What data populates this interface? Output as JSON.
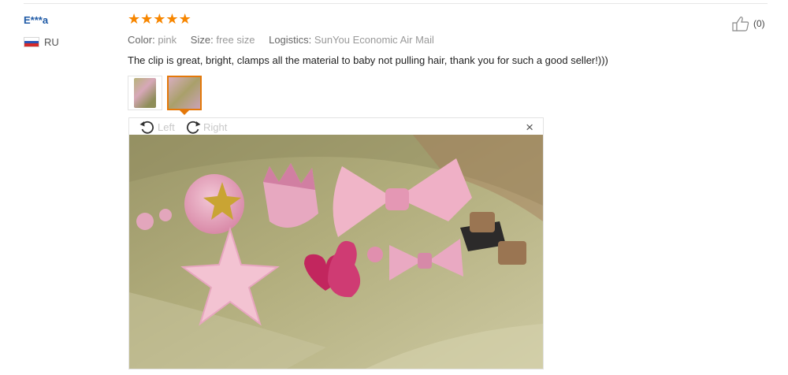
{
  "review": {
    "user": "E***a",
    "country_code": "RU",
    "rating": 5,
    "color_key": "Color:",
    "color_value": "pink",
    "size_key": "Size:",
    "size_value": "free size",
    "logistics_key": "Logistics:",
    "logistics_value": "SunYou Economic Air Mail",
    "text": "The clip is great, bright, clamps all the material to baby not pulling hair, thank you for such a good seller!)))",
    "helpful_count": "(0)"
  },
  "viewer": {
    "rotate_left": "Left",
    "rotate_right": "Right",
    "close": "×"
  },
  "colors": {
    "star": "#f78600",
    "username": "#1f5aa6",
    "active_border": "#e4780a"
  }
}
